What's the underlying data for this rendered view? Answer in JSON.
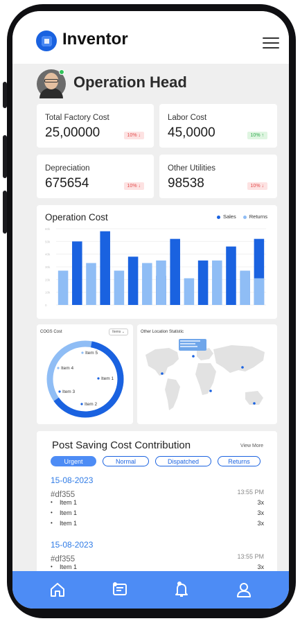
{
  "app": {
    "title": "Inventor"
  },
  "profile": {
    "role": "Operation Head"
  },
  "stats": [
    {
      "label": "Total Factory Cost",
      "value": "25,00000",
      "badge": "10% ↓",
      "trend": "down"
    },
    {
      "label": "Labor Cost",
      "value": "45,0000",
      "badge": "10% ↑",
      "trend": "up"
    },
    {
      "label": "Depreciation",
      "value": "675654",
      "badge": "10% ↓",
      "trend": "down"
    },
    {
      "label": "Other Utilities",
      "value": "98538",
      "badge": "10% ↓",
      "trend": "down"
    }
  ],
  "chart_data": {
    "type": "bar",
    "title": "Operation Cost",
    "legend_position": "top-right",
    "ylim": [
      0,
      60
    ],
    "yticks": [
      "0",
      "10k",
      "20k",
      "30k",
      "40k",
      "50k",
      "60k"
    ],
    "series": [
      {
        "name": "Sales",
        "color": "#1a62e0",
        "values": [
          null,
          50,
          null,
          58,
          null,
          38,
          null,
          23,
          52,
          null,
          35,
          null,
          46,
          26,
          52
        ]
      },
      {
        "name": "Returns",
        "color": "#8fbdf5",
        "values": [
          27,
          null,
          33,
          null,
          27,
          null,
          33,
          35,
          null,
          21,
          null,
          35,
          null,
          27,
          21
        ]
      }
    ],
    "grid": true
  },
  "cogs": {
    "title": "COGS Cost",
    "dropdown": "Items",
    "items": [
      "Item 5",
      "Item 4",
      "Item 1",
      "Item 3",
      "Item 2"
    ],
    "colors": {
      "ring_dark": "#1a62e0",
      "ring_light": "#8fbdf5"
    }
  },
  "location": {
    "title": "Other Location Statistic"
  },
  "post_saving": {
    "title": "Post Saving Cost Contribution",
    "view_more": "View More",
    "tabs": [
      "Urgent",
      "Normal",
      "Dispatched",
      "Returns"
    ],
    "entries": [
      {
        "date": "15-08-2023",
        "id": "#df355",
        "time": "13:55 PM",
        "items": [
          {
            "name": "Item 1",
            "qty": "3x"
          },
          {
            "name": "Item 1",
            "qty": "3x"
          },
          {
            "name": "Item 1",
            "qty": "3x"
          }
        ]
      },
      {
        "date": "15-08-2023",
        "id": "#df355",
        "time": "13:55 PM",
        "items": [
          {
            "name": "Item 1",
            "qty": "3x"
          }
        ]
      }
    ]
  },
  "nav": [
    "home-icon",
    "message-icon",
    "bell-icon",
    "user-icon"
  ],
  "colors": {
    "accent": "#4d8cf5",
    "brand": "#1a62e0",
    "danger": "#e24b4b",
    "success": "#2eaa4c"
  }
}
